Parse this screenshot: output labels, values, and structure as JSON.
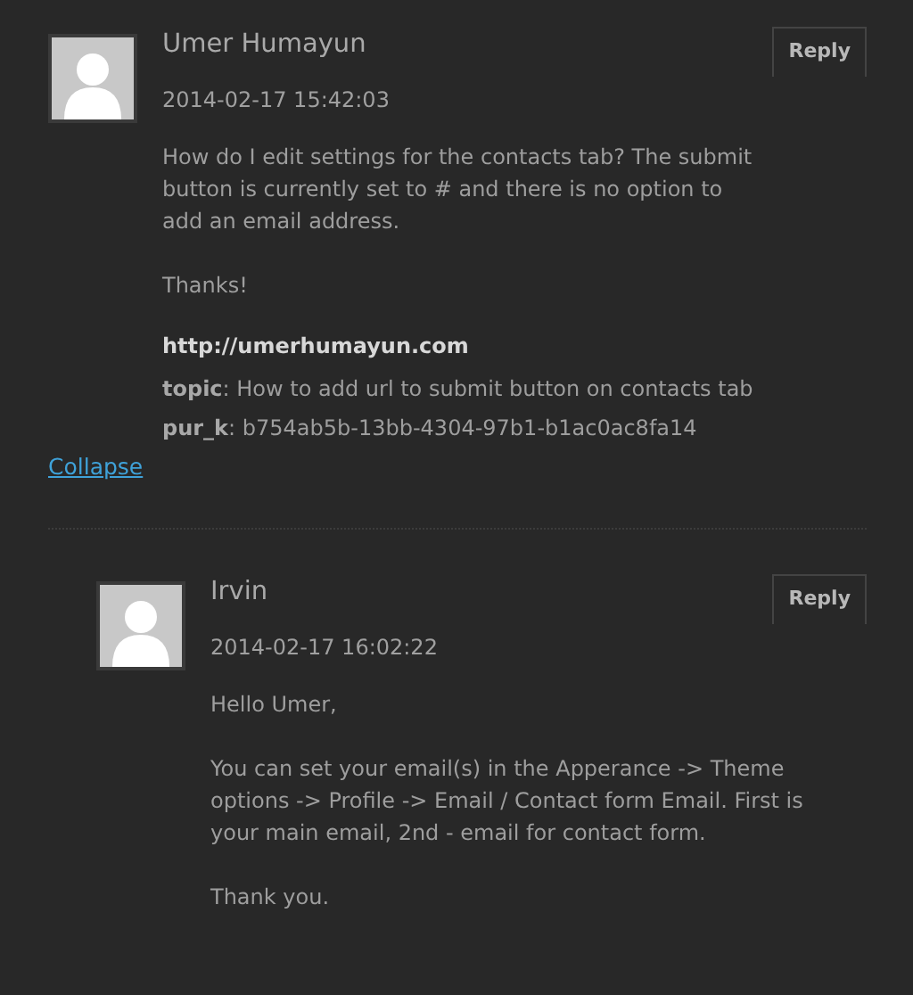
{
  "comments": [
    {
      "author": "Umer Humayun",
      "date": "2014-02-17 15:42:03",
      "reply": "Reply",
      "paragraphs": [
        "How do I edit settings for the contacts tab? The submit button is currently set to # and there is no option to add an email address.",
        "Thanks!"
      ],
      "url": "http://umerhumayun.com",
      "meta": [
        "**topic**: How to add url to submit button on contacts tab",
        "**pur_k**: b754ab5b-13bb-4304-97b1-b1ac0ac8fa14"
      ],
      "link": "Collapse",
      "children": [
        {
          "author": "Irvin",
          "date": "2014-02-17 16:02:22",
          "reply": "Reply",
          "paragraphs": [
            "Hello Umer,",
            "You can set your email(s) in the Apperance -> Theme options -> Profile -> Email / Contact form Email. First is your main email, 2nd - email for contact form.",
            "Thank you."
          ]
        }
      ]
    }
  ]
}
